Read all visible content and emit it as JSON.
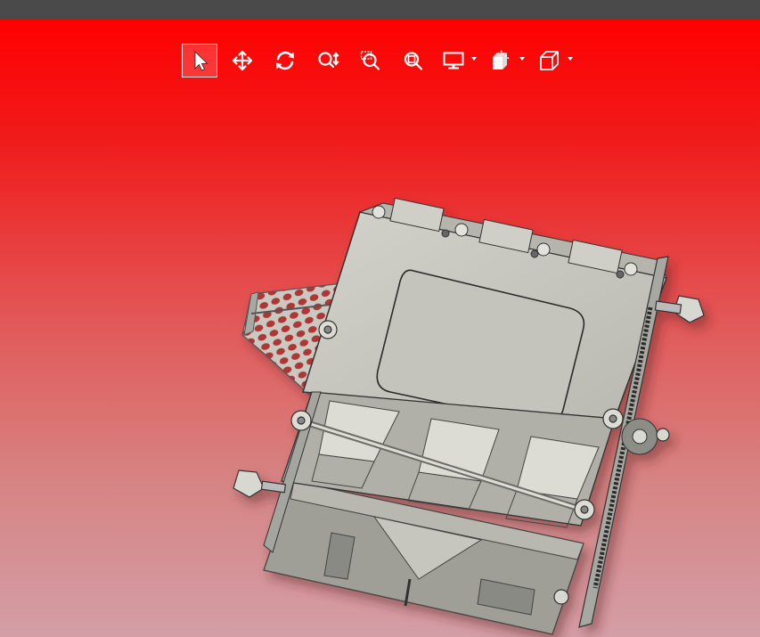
{
  "app": {
    "kind": "3D CAD model viewer",
    "colors": {
      "titlebar": "#4a4a4a",
      "background_top": "#ff0000",
      "background_bottom": "#d49ea6",
      "toolbar_icon": "#ffffff",
      "model_body": "#c8c8c0",
      "model_shadow": "#8e8e88"
    }
  },
  "toolbar": {
    "buttons": [
      {
        "id": "select",
        "icon": "pointer-icon",
        "active": true
      },
      {
        "id": "pan",
        "icon": "move-arrows-icon",
        "active": false
      },
      {
        "id": "rotate",
        "icon": "rotate-icon",
        "active": false
      },
      {
        "id": "zoom",
        "icon": "zoom-updown-icon",
        "active": false
      },
      {
        "id": "zoom-window",
        "icon": "zoom-window-icon",
        "active": false
      },
      {
        "id": "zoom-fit",
        "icon": "zoom-fit-icon",
        "active": false
      },
      {
        "id": "display",
        "icon": "monitor-icon",
        "has_dropdown": true
      },
      {
        "id": "section",
        "icon": "section-view-icon",
        "has_dropdown": true
      },
      {
        "id": "view-cube",
        "icon": "cube-icon",
        "has_dropdown": true
      }
    ]
  }
}
